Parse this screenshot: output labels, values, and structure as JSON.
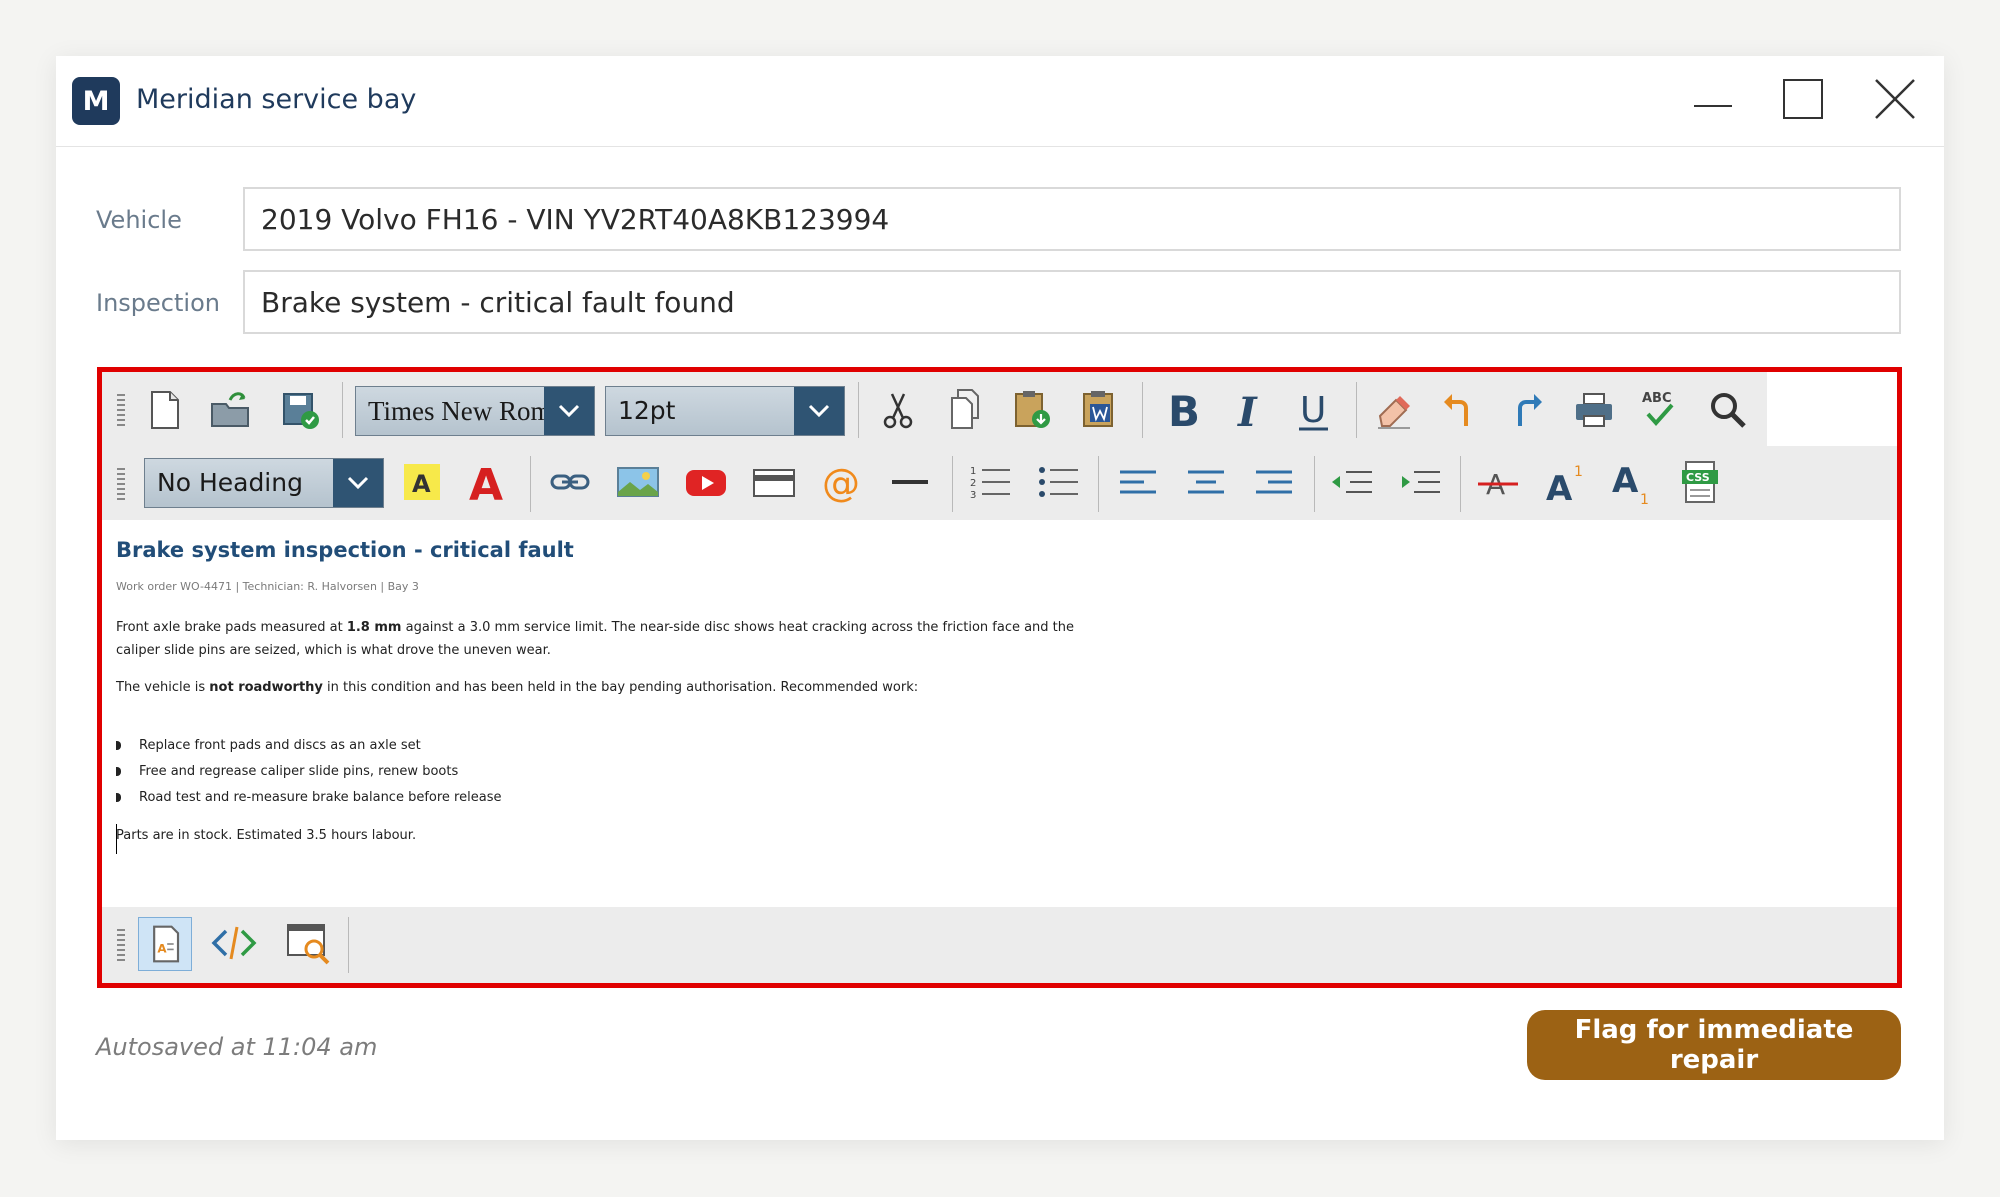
{
  "window": {
    "app_letter": "M",
    "title": "Meridian service bay"
  },
  "form": {
    "vehicle_label": "Vehicle",
    "vehicle_value": "2019 Volvo FH16 - VIN YV2RT40A8KB123994",
    "inspection_label": "Inspection",
    "inspection_value": "Brake system - critical fault found"
  },
  "toolbar": {
    "font_family": "Times New Roman",
    "font_size": "12pt",
    "heading_style": "No Heading",
    "spellcheck_text": "ABC",
    "css_text": "CSS"
  },
  "document": {
    "title": "Brake system inspection - critical fault",
    "meta": "Work order WO-4471  |  Technician: R. Halvorsen  |  Bay 3",
    "p1_a": "Front axle brake pads measured at ",
    "p1_bold": "1.8 mm",
    "p1_b": " against a 3.0 mm service limit. The near-side disc shows heat cracking across the friction face and the caliper slide pins are seized, which is what drove the uneven wear.",
    "p2_a": "The vehicle is ",
    "p2_bold": "not roadworthy",
    "p2_b": " in this condition and has been held in the bay pending authorisation. Recommended work:",
    "items": [
      "Replace front pads and discs as an axle set",
      "Free and regrease caliper slide pins, renew boots",
      "Road test and re-measure brake balance before release"
    ],
    "p3": "Parts are in stock. Estimated 3.5 hours labour."
  },
  "footer": {
    "status": "Autosaved at 11:04 am",
    "primary_button": "Flag for immediate repair"
  },
  "colors": {
    "accent": "#1f3a5c",
    "highlight_border": "#e00000",
    "primary": "#9c6214"
  }
}
